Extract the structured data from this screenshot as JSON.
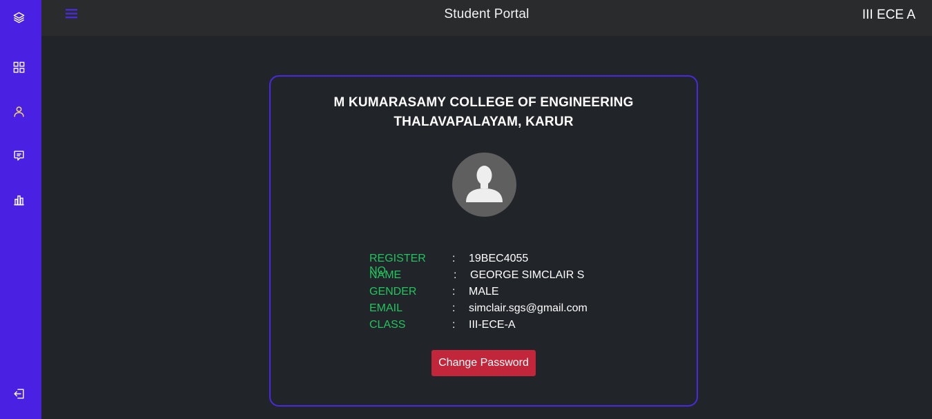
{
  "topbar": {
    "title": "Student Portal",
    "class_label": "III ECE A"
  },
  "sidebar": {
    "items": [
      {
        "icon": "layers-icon"
      },
      {
        "icon": "dashboard-grid-icon"
      },
      {
        "icon": "user-icon",
        "active": true
      },
      {
        "icon": "message-icon"
      },
      {
        "icon": "bar-chart-icon"
      },
      {
        "icon": "logout-icon"
      }
    ]
  },
  "profile": {
    "college_line1": "M KUMARASAMY COLLEGE OF ENGINEERING",
    "college_line2": "THALAVAPALAYAM, KARUR",
    "colon": ":",
    "fields": [
      {
        "label": "REGISTER NO",
        "value": "19BEC4055"
      },
      {
        "label": "NAME",
        "value": "GEORGE SIMCLAIR S"
      },
      {
        "label": "GENDER",
        "value": "MALE"
      },
      {
        "label": "EMAIL",
        "value": "simclair.sgs@gmail.com"
      },
      {
        "label": "CLASS",
        "value": "III-ECE-A"
      }
    ],
    "change_password_label": "Change Password"
  },
  "colors": {
    "sidebar": "#4a20e3",
    "label_green": "#22c55e",
    "button_red": "#c1263b",
    "active_icon": "#f5d76e"
  }
}
